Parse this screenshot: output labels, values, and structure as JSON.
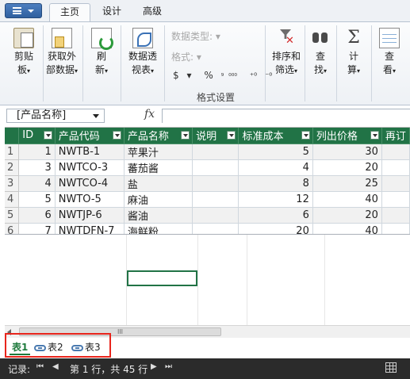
{
  "ribbon": {
    "tabs": [
      {
        "label": "主页",
        "active": true
      },
      {
        "label": "设计",
        "active": false
      },
      {
        "label": "高级",
        "active": false
      }
    ],
    "buttons": {
      "clipboard": {
        "line1": "剪贴",
        "line2": "板",
        "icon": "clipboard-icon"
      },
      "get_external": {
        "line1": "获取外",
        "line2": "部数据",
        "icon": "external-data-icon"
      },
      "refresh": {
        "line1": "刷",
        "line2": "新",
        "icon": "refresh-icon"
      },
      "data_view": {
        "line1": "数据透",
        "line2": "视表",
        "icon": "pivot-icon"
      },
      "sort_filter": {
        "line1": "排序和",
        "line2": "筛选",
        "icon": "sort-filter-icon"
      },
      "find": {
        "line1": "查",
        "line2": "找",
        "icon": "binoculars-icon"
      },
      "calculate": {
        "line1": "计",
        "line2": "算",
        "icon": "sigma-icon"
      },
      "view": {
        "line1": "查",
        "line2": "看",
        "icon": "view-icon"
      }
    },
    "dropdown_mark": "▾",
    "format_group": {
      "data_type_label": "数据类型:",
      "format_label": "格式:",
      "symbols": [
        "$",
        "%",
        "⁹",
        "⁰⁰⁰",
        "⁺⁰",
        "⁻⁰"
      ],
      "group_label": "格式设置"
    }
  },
  "formula_bar": {
    "name_box": "[产品名称]",
    "fx_label": "fx",
    "value": ""
  },
  "table": {
    "columns": [
      "ID",
      "产品代码",
      "产品名称",
      "说明",
      "标准成本",
      "列出价格",
      "再订"
    ],
    "rows": [
      {
        "row": "1",
        "id": "1",
        "code": "NWTB-1",
        "name": "苹果汁",
        "desc": "",
        "cost": "5",
        "price": "30"
      },
      {
        "row": "2",
        "id": "3",
        "code": "NWTCO-3",
        "name": "蕃茄酱",
        "desc": "",
        "cost": "4",
        "price": "20"
      },
      {
        "row": "3",
        "id": "4",
        "code": "NWTCO-4",
        "name": "盐",
        "desc": "",
        "cost": "8",
        "price": "25"
      },
      {
        "row": "4",
        "id": "5",
        "code": "NWTO-5",
        "name": "麻油",
        "desc": "",
        "cost": "12",
        "price": "40"
      },
      {
        "row": "5",
        "id": "6",
        "code": "NWTJP-6",
        "name": "酱油",
        "desc": "",
        "cost": "6",
        "price": "20"
      },
      {
        "row": "6",
        "id": "7",
        "code": "NWTDFN-7",
        "name": "海鲜粉",
        "desc": "",
        "cost": "20",
        "price": "40"
      }
    ]
  },
  "scrollbar": {
    "thumb_label": "III"
  },
  "sheet_tabs": [
    {
      "label": "表1",
      "active": true,
      "linked": false
    },
    {
      "label": "表2",
      "active": false,
      "linked": true
    },
    {
      "label": "表3",
      "active": false,
      "linked": true
    }
  ],
  "status": {
    "record_label": "记录:",
    "first": "⏮",
    "prev": "◀",
    "position": "第 1 行，共 45 行",
    "next": "▶",
    "last": "⏭"
  },
  "colors": {
    "accent": "#217346",
    "highlight": "#e8251c"
  }
}
